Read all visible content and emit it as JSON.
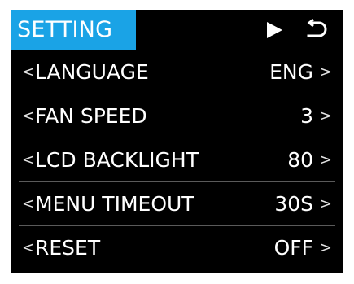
{
  "header": {
    "title": "SETTING",
    "play_icon": "play-icon",
    "back_icon": "return-icon"
  },
  "colors": {
    "accent": "#1aa3e6",
    "background": "#000000",
    "text": "#ffffff"
  },
  "settings": [
    {
      "label": "LANGUAGE",
      "value": "ENG",
      "left": "<",
      "right": ">"
    },
    {
      "label": "FAN SPEED",
      "value": "3",
      "left": "<",
      "right": ">"
    },
    {
      "label": "LCD BACKLIGHT",
      "value": "80",
      "left": "<",
      "right": ">"
    },
    {
      "label": "MENU TIMEOUT",
      "value": "30S",
      "left": "<",
      "right": ">"
    },
    {
      "label": "RESET",
      "value": "OFF",
      "left": "<",
      "right": ">"
    }
  ]
}
